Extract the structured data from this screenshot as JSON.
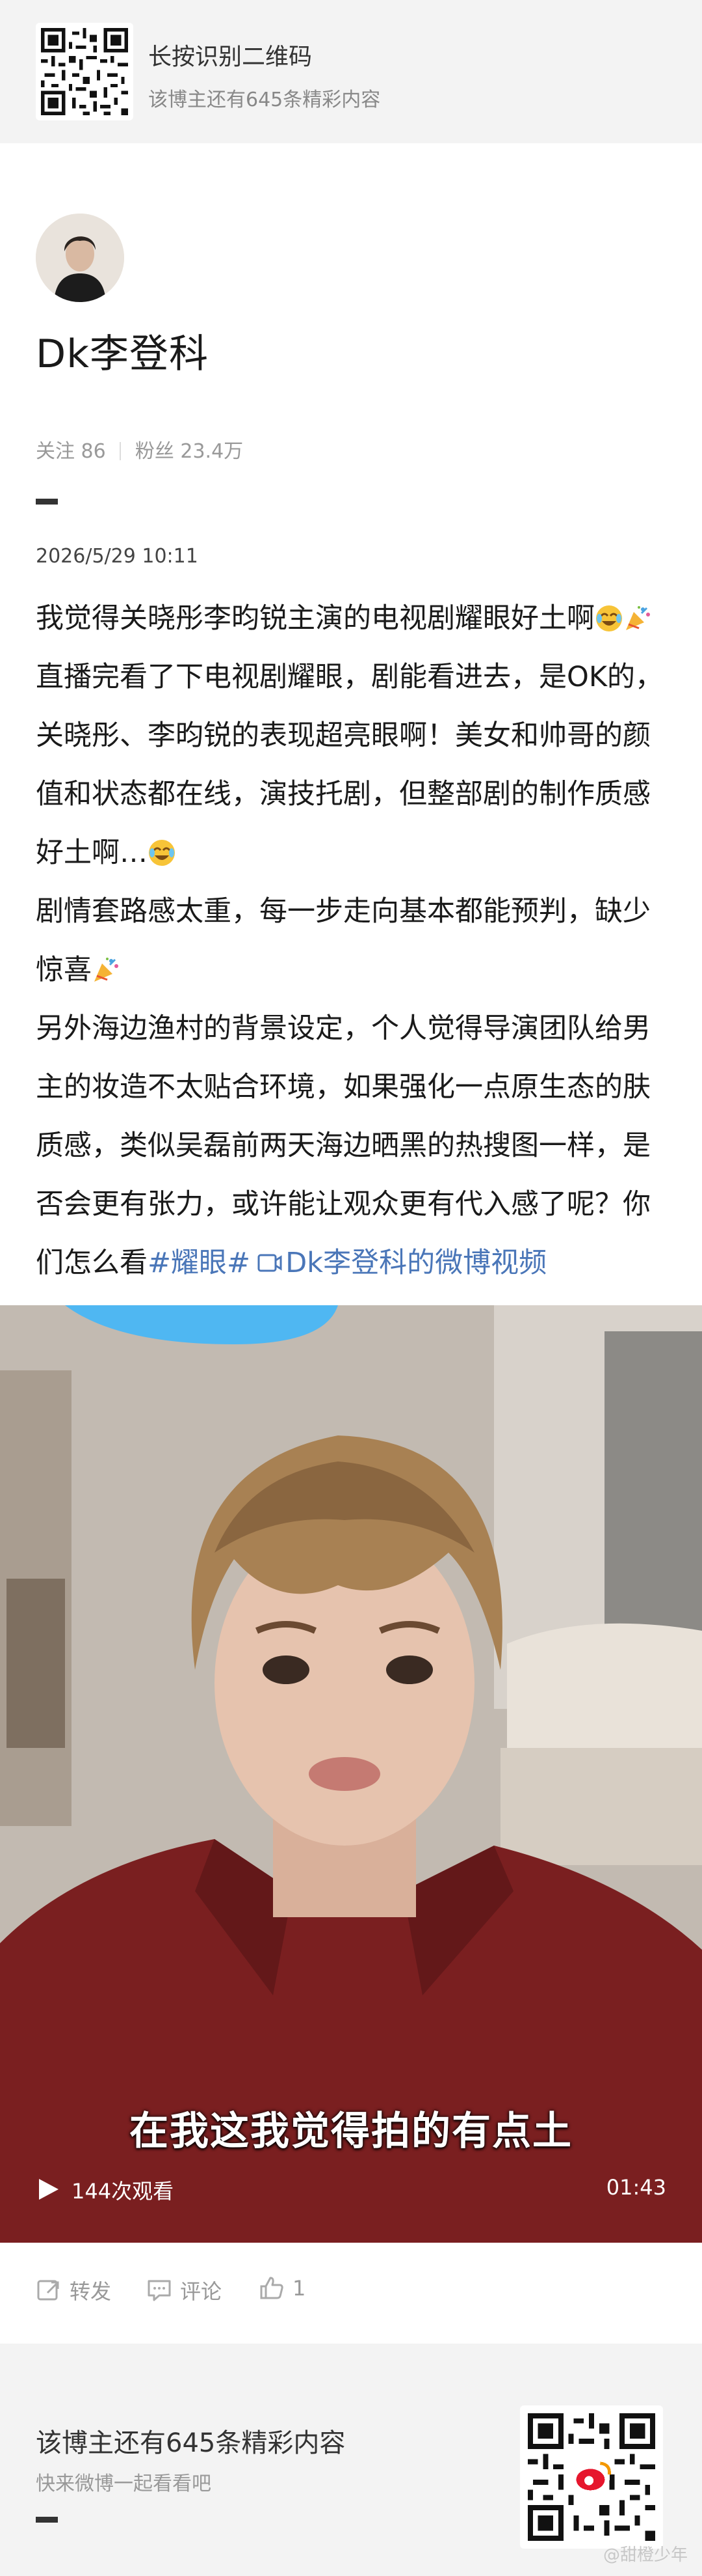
{
  "top_banner": {
    "title": "长按识别二维码",
    "subtitle": "该博主还有645条精彩内容"
  },
  "profile": {
    "name": "Dk李登科",
    "follow_label": "关注",
    "follow_count": "86",
    "fans_label": "粉丝",
    "fans_count": "23.4万"
  },
  "post": {
    "time": "2026/5/29 10:11",
    "line1": "我觉得关晓彤李昀锐主演的电视剧耀眼好土啊",
    "para2": "直播完看了下电视剧耀眼，剧能看进去，是OK的，关晓彤、李昀锐的表现超亮眼啊！美女和帅哥的颜值和状态都在线，演技托剧，但整部剧的制作质感好土啊…",
    "para3": "剧情套路感太重，每一步走向基本都能预判，缺少惊喜",
    "para4": "另外海边渔村的背景设定，个人觉得导演团队给男主的妆造不太贴合环境，如果强化一点原生态的肤质感，类似吴磊前两天海边晒黑的热搜图一样，是否会更有张力，或许能让观众更有代入感了呢？你们怎么看",
    "hashtag": "#耀眼#",
    "video_link": "Dk李登科的微博视频",
    "emoji_laugh": "laughing-crying-emoji",
    "emoji_party": "party-popper-emoji"
  },
  "video": {
    "caption": "在我这我觉得拍的有点土",
    "views": "144次观看",
    "duration": "01:43"
  },
  "actions": {
    "repost_label": "转发",
    "comment_label": "评论",
    "like_count": "1"
  },
  "bottom_banner": {
    "title": "该博主还有645条精彩内容",
    "subtitle": "快来微博一起看看吧",
    "watermark": "@甜橙少年"
  },
  "colors": {
    "link": "#4a76b8",
    "banner_bg": "#f3f3f3",
    "muted": "#999999"
  }
}
